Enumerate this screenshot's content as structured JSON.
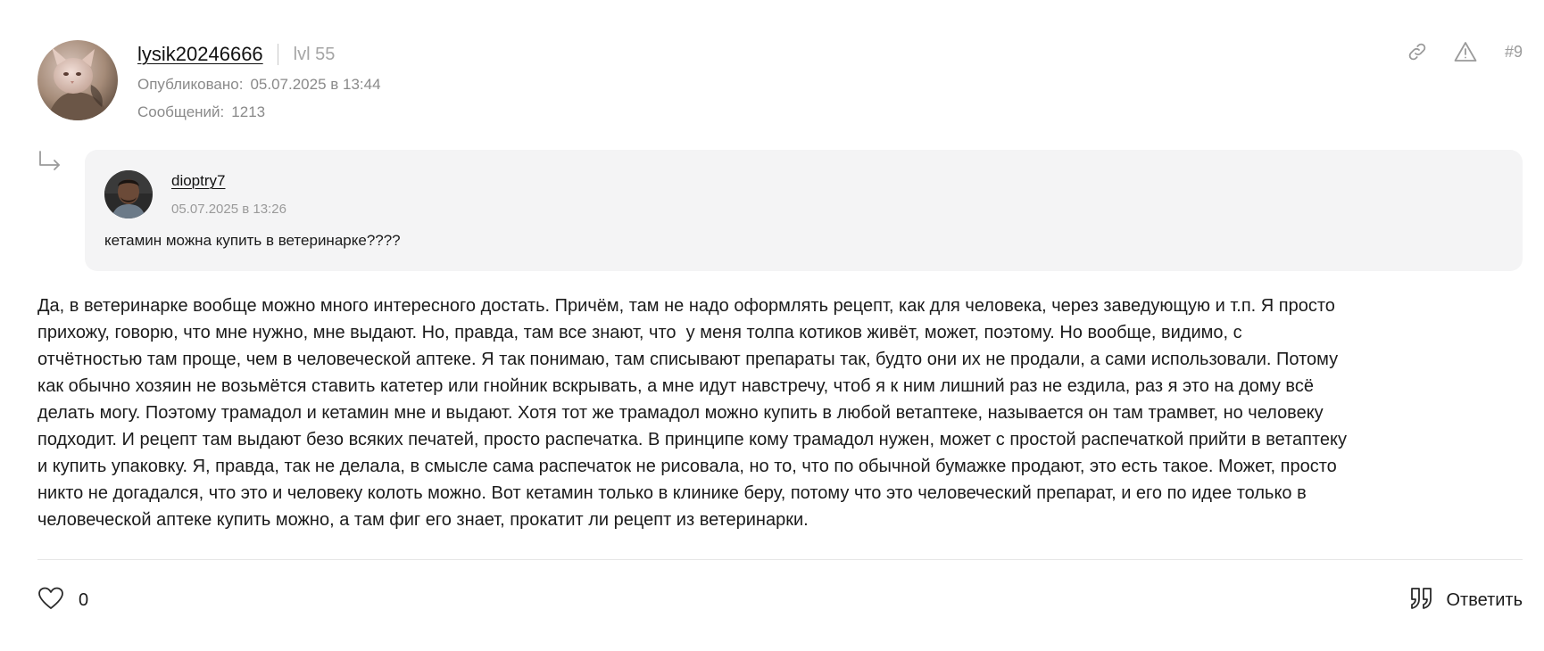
{
  "post": {
    "author": {
      "username": "lysik20246666",
      "level": "lvl 55",
      "avatar": "avatar-cat-photo"
    },
    "published_label": "Опубликовано:",
    "published_value": "05.07.2025 в 13:44",
    "messages_label": "Сообщений:",
    "messages_value": "1213",
    "actions": {
      "link_icon": "link-icon",
      "report_icon": "warning-icon",
      "post_number": "#9"
    },
    "quote": {
      "username": "dioptry7",
      "date": "05.07.2025 в 13:26",
      "text": "кетамин можна купить в ветеринарке????",
      "avatar": "avatar-person-photo",
      "reply_icon": "reply-arrow-icon"
    },
    "body": "Да, в ветеринарке вообще можно много интересного достать. Причём, там не надо оформлять рецепт, как для человека, через заведующую и т.п. Я просто\nприхожу, говорю, что мне нужно, мне выдают. Но, правда, там все знают, что  у меня толпа котиков живёт, может, поэтому. Но вообще, видимо, с\nотчётностью там проще, чем в человеческой аптеке. Я так понимаю, там списывают препараты так, будто они их не продали, а сами использовали. Потому\nкак обычно хозяин не возьмётся ставить катетер или гнойник вскрывать, а мне идут навстречу, чтоб я к ним лишний раз не ездила, раз я это на дому всё\nделать могу. Поэтому трамадол и кетамин мне и выдают. Хотя тот же трамадол можно купить в любой ветаптеке, называется он там трамвет, но человеку\nподходит. И рецепт там выдают безо всяких печатей, просто распечатка. В принципе кому трамадол нужен, может с простой распечаткой прийти в ветаптеку\nи купить упаковку. Я, правда, так не делала, в смысле сама распечаток не рисовала, но то, что по обычной бумажке продают, это есть такое. Может, просто\nникто не догадался, что это и человеку колоть можно. Вот кетамин только в клинике беру, потому что это человеческий препарат, и его по идее только в\nчеловеческой аптеке купить можно, а там фиг его знает, прокатит ли рецепт из ветеринарки.",
    "footer": {
      "like_icon": "heart-icon",
      "like_count": "0",
      "reply_icon": "quote-icon",
      "reply_label": "Ответить"
    }
  }
}
